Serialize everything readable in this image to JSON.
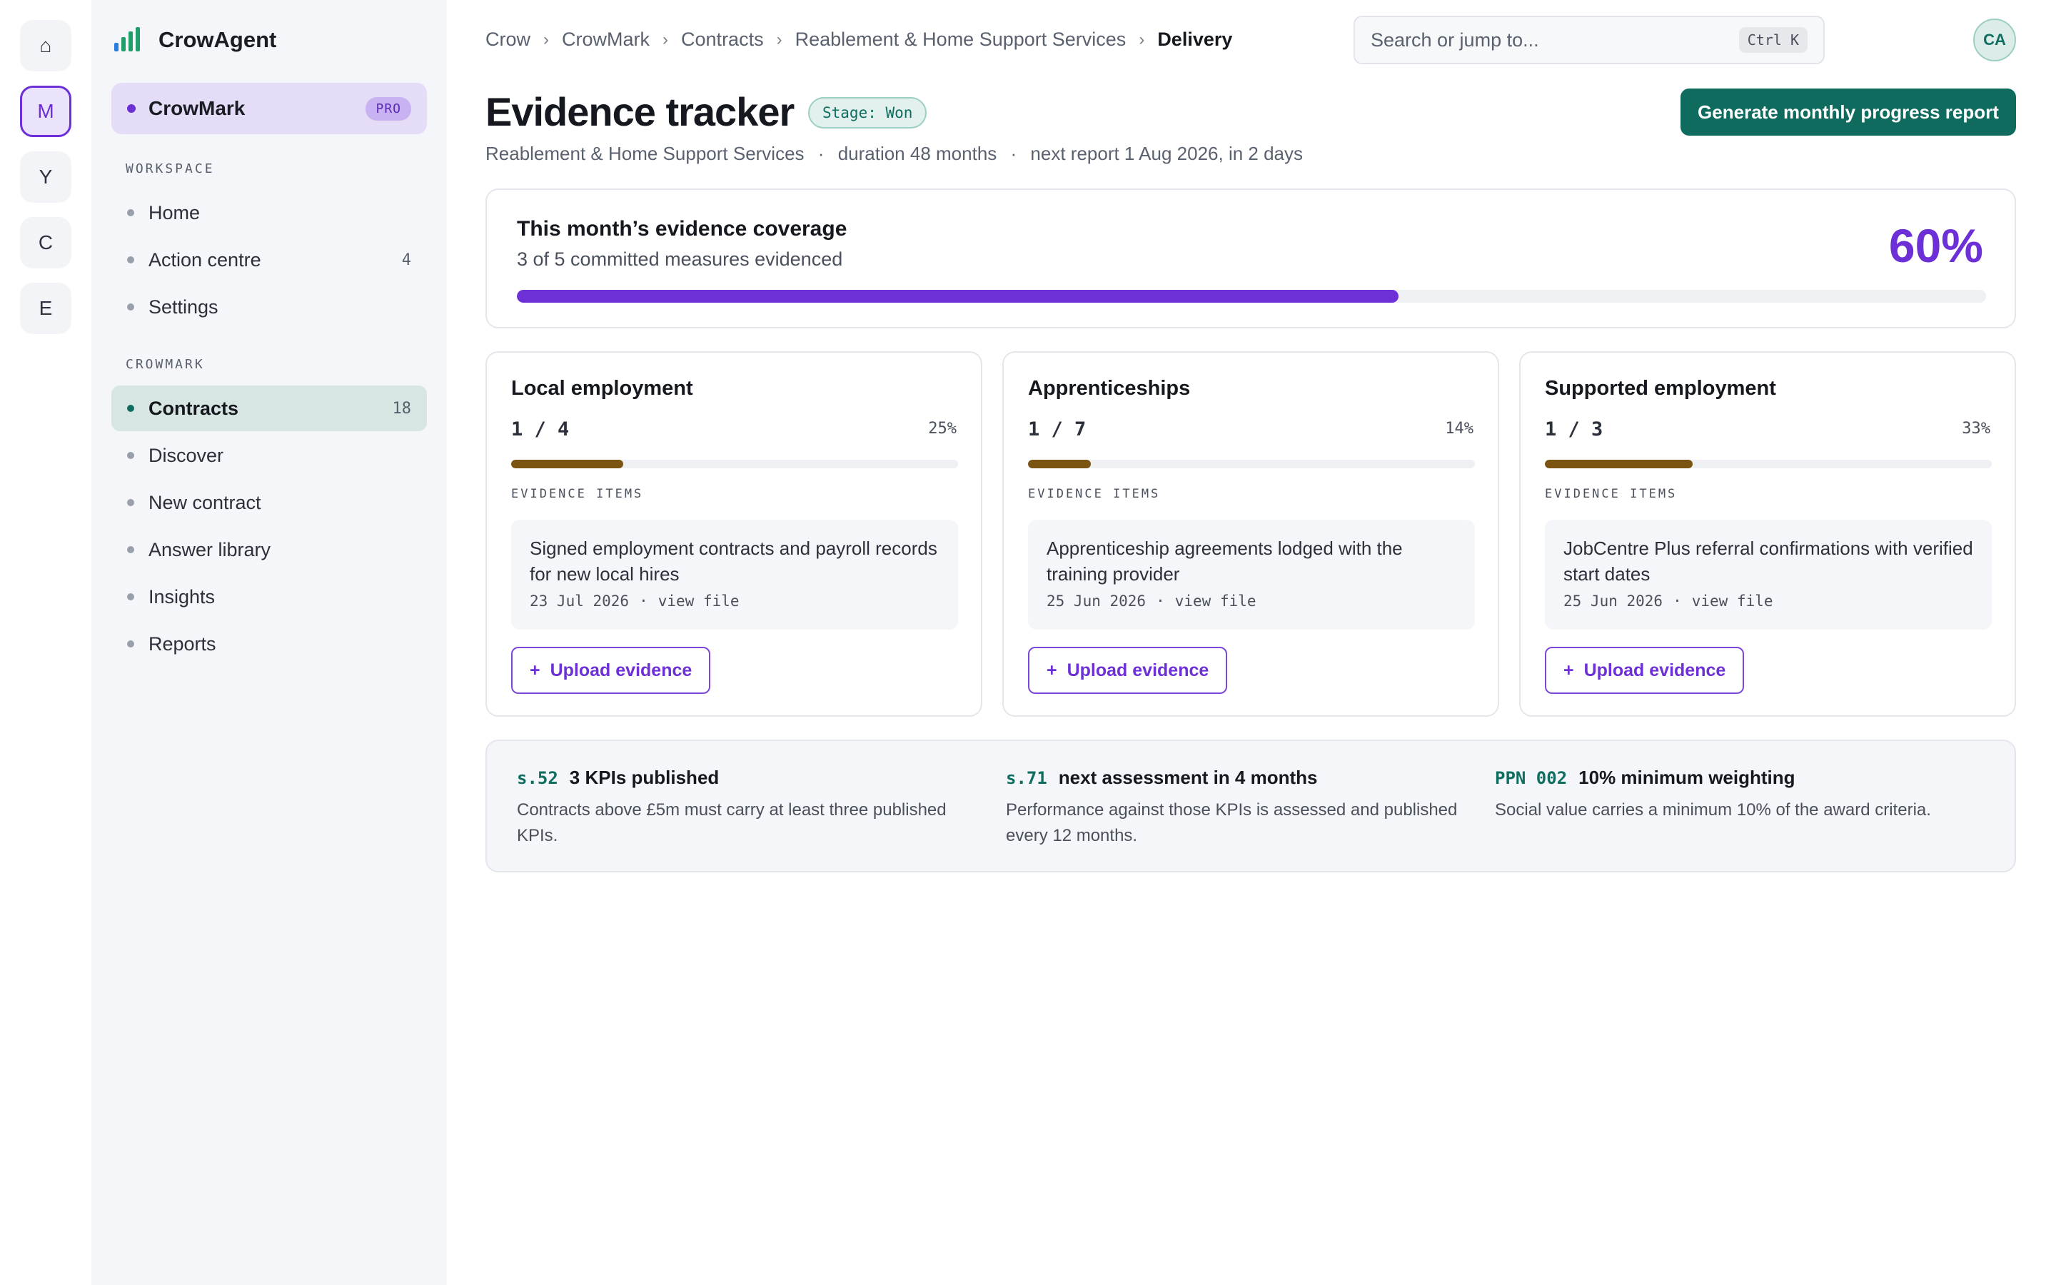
{
  "rail": {
    "items": [
      {
        "label": "⌂",
        "icon": "home-icon"
      },
      {
        "label": "M"
      },
      {
        "label": "Y"
      },
      {
        "label": "C"
      },
      {
        "label": "E"
      }
    ]
  },
  "sidebar": {
    "brand": "CrowAgent",
    "org": {
      "name": "CrowMark",
      "badge": "PRO"
    },
    "workspace_label": "WORKSPACE",
    "workspace_items": [
      {
        "label": "Home",
        "count": ""
      },
      {
        "label": "Action centre",
        "count": "4"
      },
      {
        "label": "Settings",
        "count": ""
      }
    ],
    "crowmark_label": "CROWMARK",
    "crowmark_items": [
      {
        "label": "Contracts",
        "count": "18"
      },
      {
        "label": "Discover",
        "count": ""
      },
      {
        "label": "New contract",
        "count": ""
      },
      {
        "label": "Answer library",
        "count": ""
      },
      {
        "label": "Insights",
        "count": ""
      },
      {
        "label": "Reports",
        "count": ""
      }
    ]
  },
  "header": {
    "breadcrumb": [
      "Crow",
      "CrowMark",
      "Contracts",
      "Reablement & Home Support Services",
      "Delivery"
    ],
    "breadcrumb_separator": "›",
    "search_placeholder": "Search or jump to...",
    "search_shortcut": "Ctrl K",
    "avatar_initials": "CA"
  },
  "page": {
    "title": "Evidence tracker",
    "stage": "Stage: Won",
    "meta": [
      "Reablement & Home Support Services",
      "duration 48 months",
      "next report 1 Aug 2026, in 2 days"
    ],
    "meta_separator": "·",
    "primary_action": "Generate monthly progress report"
  },
  "coverage": {
    "title": "This month’s evidence coverage",
    "subtitle": "3 of 5 committed measures evidenced",
    "percent_label": "60%",
    "fraction": 0.6
  },
  "measures": [
    {
      "title": "Local employment",
      "ratio": "1 / 4",
      "percent_label": "25%",
      "fraction": 0.25,
      "items_label": "EVIDENCE ITEMS",
      "evidence_text": "Signed employment contracts and payroll records for new local hires",
      "evidence_date": "23 Jul 2026",
      "evidence_link": "view file",
      "upload_label": "Upload evidence"
    },
    {
      "title": "Apprenticeships",
      "ratio": "1 / 7",
      "percent_label": "14%",
      "fraction": 0.14,
      "items_label": "EVIDENCE ITEMS",
      "evidence_text": "Apprenticeship agreements lodged with the training provider",
      "evidence_date": "25 Jun 2026",
      "evidence_link": "view file",
      "upload_label": "Upload evidence"
    },
    {
      "title": "Supported employment",
      "ratio": "1 / 3",
      "percent_label": "33%",
      "fraction": 0.33,
      "items_label": "EVIDENCE ITEMS",
      "evidence_text": "JobCentre Plus referral confirmations with verified start dates",
      "evidence_date": "25 Jun 2026",
      "evidence_link": "view file",
      "upload_label": "Upload evidence"
    }
  ],
  "policies": [
    {
      "code": "s.52",
      "title": "3 KPIs published",
      "desc": "Contracts above £5m must carry at least three published KPIs."
    },
    {
      "code": "s.71",
      "title": "next assessment in 4 months",
      "desc": "Performance against those KPIs is assessed and published every 12 months."
    },
    {
      "code": "PPN 002",
      "title": "10% minimum weighting",
      "desc": "Social value carries a minimum 10% of the award criteria."
    }
  ],
  "colors": {
    "accent": "#6d2fd6",
    "primary": "#0e6b5e",
    "measure_bar": "#7a5410"
  }
}
